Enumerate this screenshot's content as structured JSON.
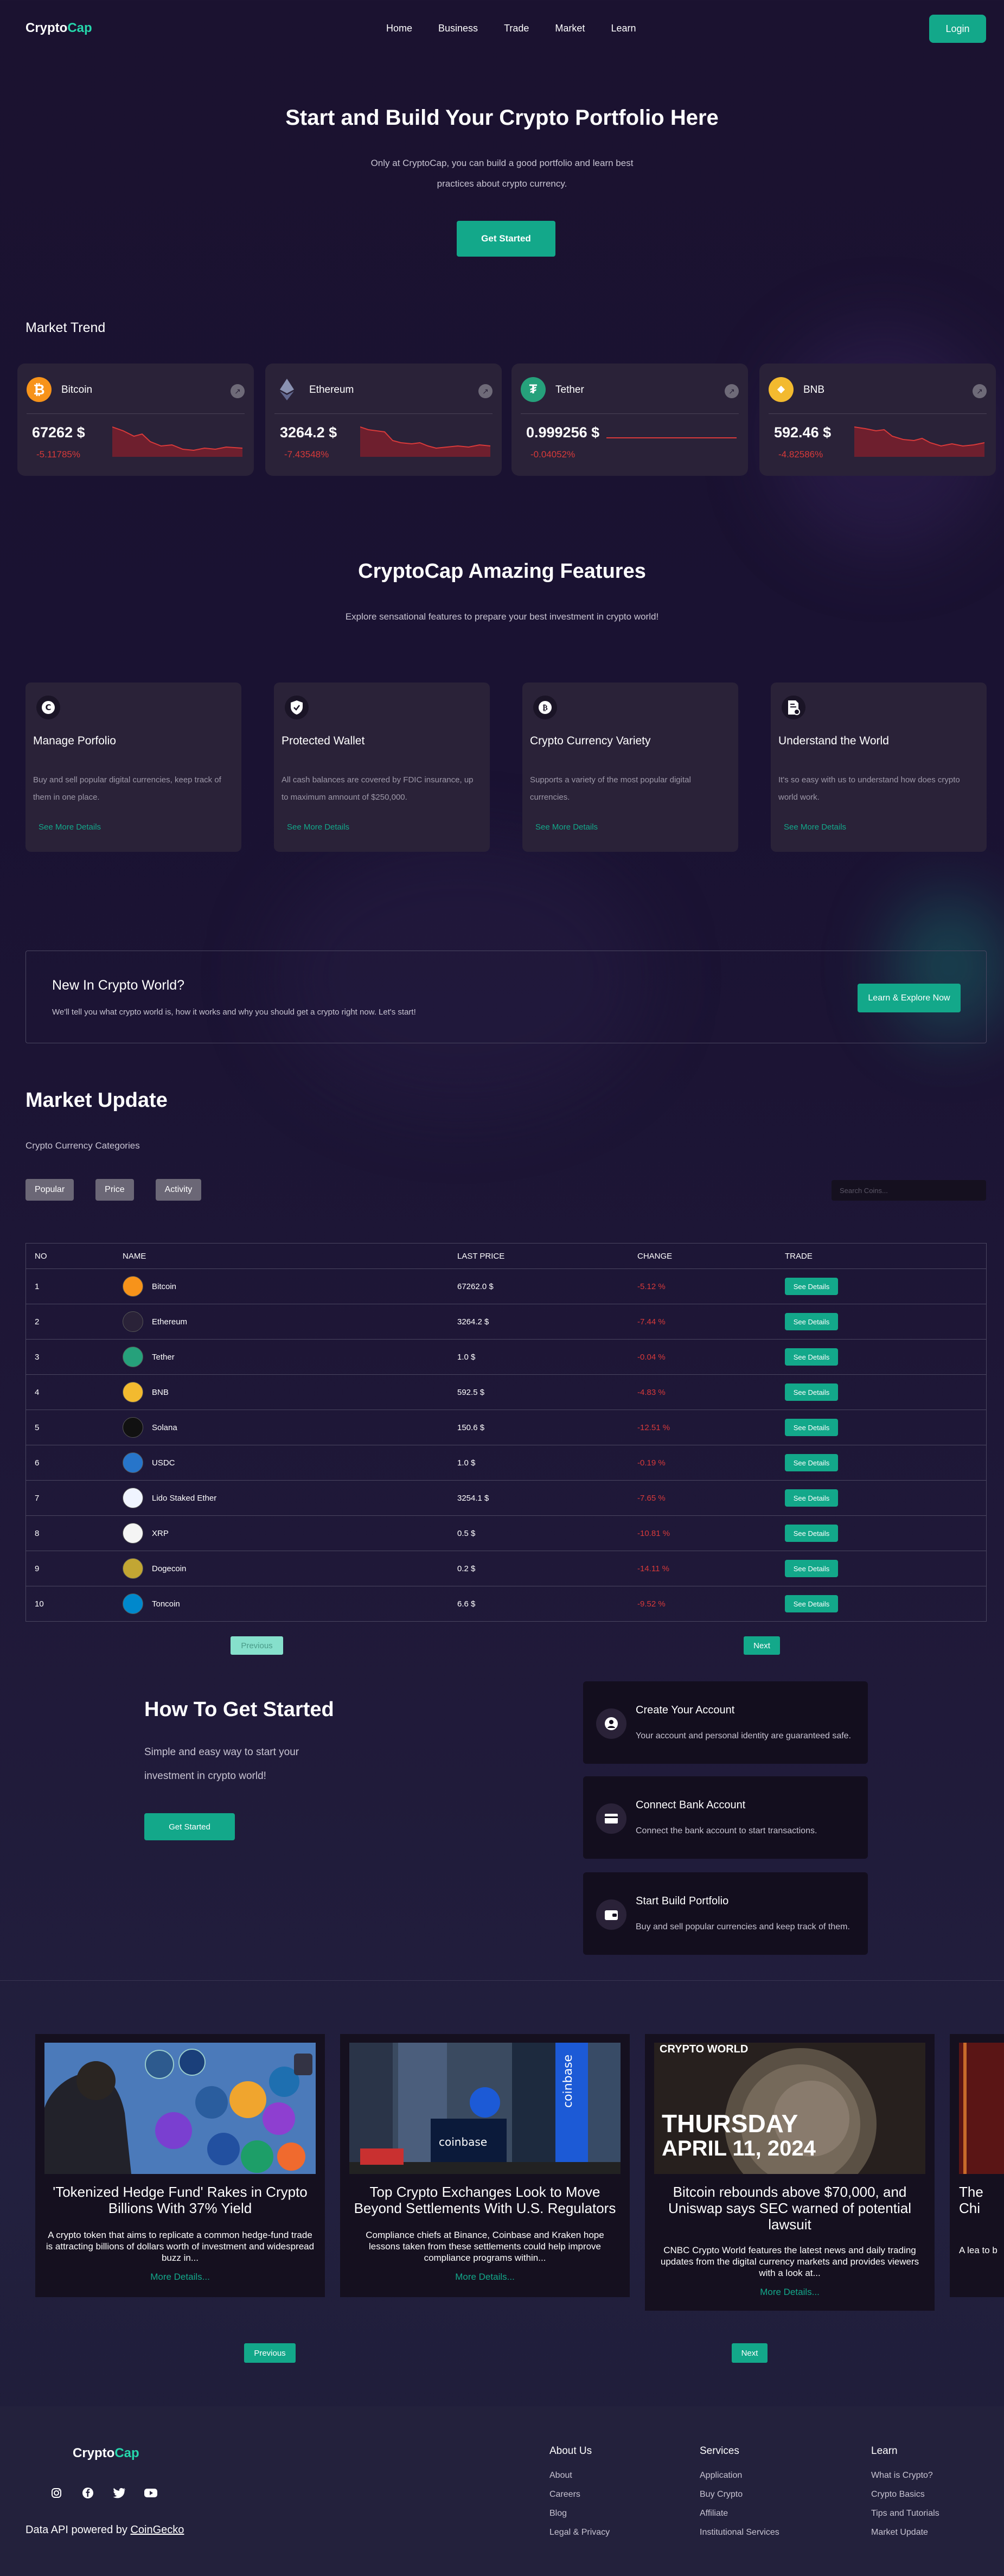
{
  "nav": {
    "logo_crypto": "Crypto",
    "logo_cap": "Cap",
    "links": [
      "Home",
      "Business",
      "Trade",
      "Market",
      "Learn"
    ],
    "login": "Login"
  },
  "hero": {
    "title": "Start and Build Your Crypto Portfolio Here",
    "subtitle": "Only at CryptoCap, you can build a good portfolio and learn best practices about crypto currency.",
    "cta": "Get Started"
  },
  "market_trend": {
    "heading": "Market Trend",
    "cards": [
      {
        "name": "Bitcoin",
        "price": "67262 $",
        "change": "-5.11785%",
        "icon": "bitcoin-icon",
        "color": "#f7931a"
      },
      {
        "name": "Ethereum",
        "price": "3264.2 $",
        "change": "-7.43548%",
        "icon": "ethereum-icon",
        "color": "#627eea"
      },
      {
        "name": "Tether",
        "price": "0.999256 $",
        "change": "-0.04052%",
        "icon": "tether-icon",
        "color": "#26a17b"
      },
      {
        "name": "BNB",
        "price": "592.46 $",
        "change": "-4.82586%",
        "icon": "bnb-icon",
        "color": "#f3ba2f"
      }
    ]
  },
  "features": {
    "title": "CryptoCap Amazing Features",
    "subtitle": "Explore sensational features to prepare your best investment in crypto world!",
    "cards": [
      {
        "title": "Manage Porfolio",
        "text": "Buy and sell popular digital currencies, keep track of them in one place.",
        "more": "See More Details"
      },
      {
        "title": "Protected Wallet",
        "text": "All cash balances are covered by FDIC insurance, up to maximum amnount of $250,000.",
        "more": "See More Details"
      },
      {
        "title": "Crypto Currency Variety",
        "text": "Supports a variety of the most popular digital currencies.",
        "more": "See More Details"
      },
      {
        "title": "Understand the World",
        "text": "It's so easy with us to understand how does crypto world work.",
        "more": "See More Details"
      }
    ]
  },
  "newbox": {
    "title": "New In Crypto World?",
    "text": "We'll tell you what crypto world is, how it works and why you should get a crypto right now. Let's start!",
    "button": "Learn & Explore Now"
  },
  "market_update": {
    "title": "Market Update",
    "subtitle": "Crypto Currency Categories",
    "tabs": [
      "Popular",
      "Price",
      "Activity"
    ],
    "search_placeholder": "Search Coins...",
    "headers": [
      "NO",
      "NAME",
      "LAST PRICE",
      "CHANGE",
      "TRADE"
    ],
    "rows": [
      {
        "no": "1",
        "name": "Bitcoin",
        "price": "67262.0 $",
        "change": "-5.12 %",
        "color": "#f7931a"
      },
      {
        "no": "2",
        "name": "Ethereum",
        "price": "3264.2 $",
        "change": "-7.44 %",
        "color": "#2a2238"
      },
      {
        "no": "3",
        "name": "Tether",
        "price": "1.0 $",
        "change": "-0.04 %",
        "color": "#26a17b"
      },
      {
        "no": "4",
        "name": "BNB",
        "price": "592.5 $",
        "change": "-4.83 %",
        "color": "#f3ba2f"
      },
      {
        "no": "5",
        "name": "Solana",
        "price": "150.6 $",
        "change": "-12.51 %",
        "color": "#111111"
      },
      {
        "no": "6",
        "name": "USDC",
        "price": "1.0 $",
        "change": "-0.19 %",
        "color": "#2775ca"
      },
      {
        "no": "7",
        "name": "Lido Staked Ether",
        "price": "3254.1 $",
        "change": "-7.65 %",
        "color": "#f0f4ff"
      },
      {
        "no": "8",
        "name": "XRP",
        "price": "0.5 $",
        "change": "-10.81 %",
        "color": "#f4f4f4"
      },
      {
        "no": "9",
        "name": "Dogecoin",
        "price": "0.2 $",
        "change": "-14.11 %",
        "color": "#c2a633"
      },
      {
        "no": "10",
        "name": "Toncoin",
        "price": "6.6 $",
        "change": "-9.52 %",
        "color": "#0088cc"
      }
    ],
    "trade_label": "See Details",
    "prev": "Previous",
    "next": "Next"
  },
  "how_to": {
    "title": "How To Get Started",
    "subtitle": "Simple and easy way to start your investment in crypto world!",
    "button": "Get Started",
    "steps": [
      {
        "title": "Create Your Account",
        "text": "Your account and personal identity are guaranteed safe."
      },
      {
        "title": "Connect Bank Account",
        "text": "Connect the bank account to start transactions."
      },
      {
        "title": "Start Build Portfolio",
        "text": "Buy and sell popular currencies and keep track of them."
      }
    ]
  },
  "news": {
    "items": [
      {
        "title": "'Tokenized Hedge Fund' Rakes in Crypto Billions With 37% Yield",
        "text": "A crypto token that aims to replicate a common hedge-fund trade is attracting billions of dollars worth of investment and widespread buzz in...",
        "more": "More Details..."
      },
      {
        "title": "Top Crypto Exchanges Look to Move Beyond Settlements With U.S. Regulators",
        "text": "Compliance chiefs at Binance, Coinbase and Kraken hope lessons taken from these settlements could help improve compliance programs within...",
        "more": "More Details..."
      },
      {
        "title": "Bitcoin rebounds above $70,000, and Uniswap says SEC warned of potential lawsuit",
        "text": "CNBC Crypto World features the latest news and daily trading updates from the digital currency markets and provides viewers with a look at...",
        "more": "More Details...",
        "img_tag": "CRYPTO WORLD",
        "img_day": "THURSDAY",
        "img_date": "APRIL 11, 2024"
      },
      {
        "title": "The Chi",
        "text": "A lea to b"
      }
    ],
    "prev": "Previous",
    "next": "Next"
  },
  "footer": {
    "logo_crypto": "Crypto",
    "logo_cap": "Cap",
    "api_text": "Data API powered by ",
    "api_link": "CoinGecko",
    "cols": [
      {
        "title": "About Us",
        "items": [
          "About",
          "Careers",
          "Blog",
          "Legal & Privacy"
        ]
      },
      {
        "title": "Services",
        "items": [
          "Application",
          "Buy Crypto",
          "Affiliate",
          "Institutional Services"
        ]
      },
      {
        "title": "Learn",
        "items": [
          "What is Crypto?",
          "Crypto Basics",
          "Tips and Tutorials",
          "Market Update"
        ]
      }
    ]
  }
}
